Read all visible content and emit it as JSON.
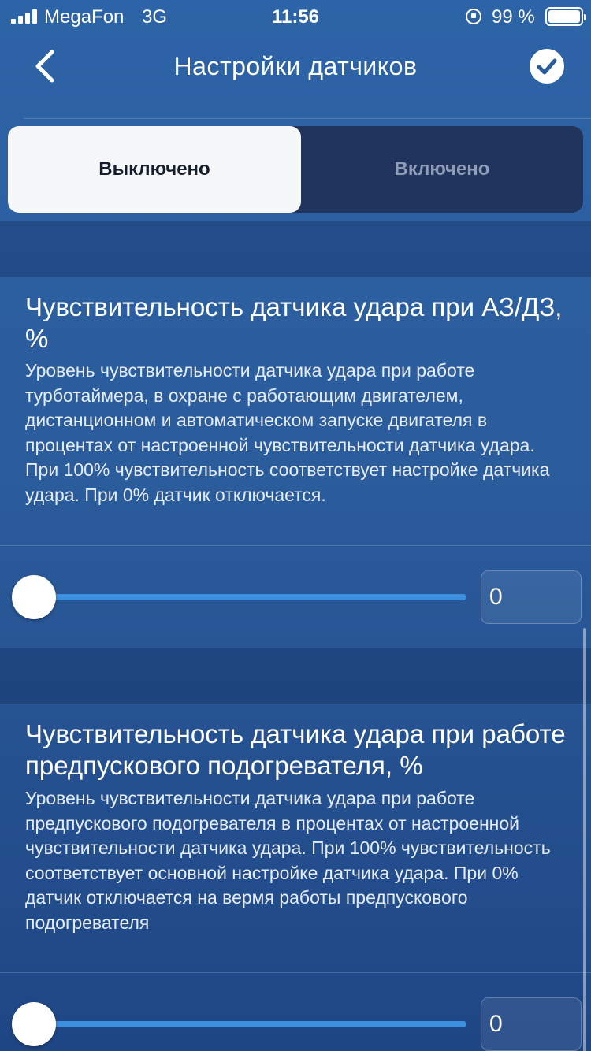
{
  "status_bar": {
    "carrier": "MegaFon",
    "network": "3G",
    "time": "11:56",
    "battery_percent": "99 %",
    "icons": [
      "signal-icon",
      "orientation-lock-icon",
      "battery-icon"
    ]
  },
  "nav": {
    "title": "Настройки датчиков",
    "back_icon": "chevron-left-icon",
    "confirm_icon": "checkmark-circle-icon"
  },
  "toggle": {
    "off_label": "Выключено",
    "on_label": "Включено",
    "selected": "off"
  },
  "sections": [
    {
      "title": "Чувствительность датчика удара при АЗ/ДЗ, %",
      "description": "Уровень чувствительности датчика удара при работе турботаймера, в охране с работающим двигателем, дистанционном и автоматическом запуске двигателя в процентах от настроенной чувствительности датчика удара. При 100% чувствительность соответствует настройке датчика удара. При 0% датчик отключается.",
      "slider_value_percent": 0,
      "value": "0"
    },
    {
      "title": "Чувствительность датчика удара при работе предпускового подогревателя, %",
      "description": "Уровень чувствительности датчика удара при работе предпускового подогревателя в процентах от настроенной чувствительности датчика удара. При 100% чувствительность соответствует основной настройке датчика удара. При 0% датчик отключается на вермя работы предпускового подогревателя",
      "slider_value_percent": 0,
      "value": "0"
    }
  ],
  "colors": {
    "background": "#2b5c9c",
    "toggle_selected_bg": "#f6f7f9",
    "toggle_unselected_bg": "#21345e",
    "slider_track": "#3d8fe0"
  }
}
